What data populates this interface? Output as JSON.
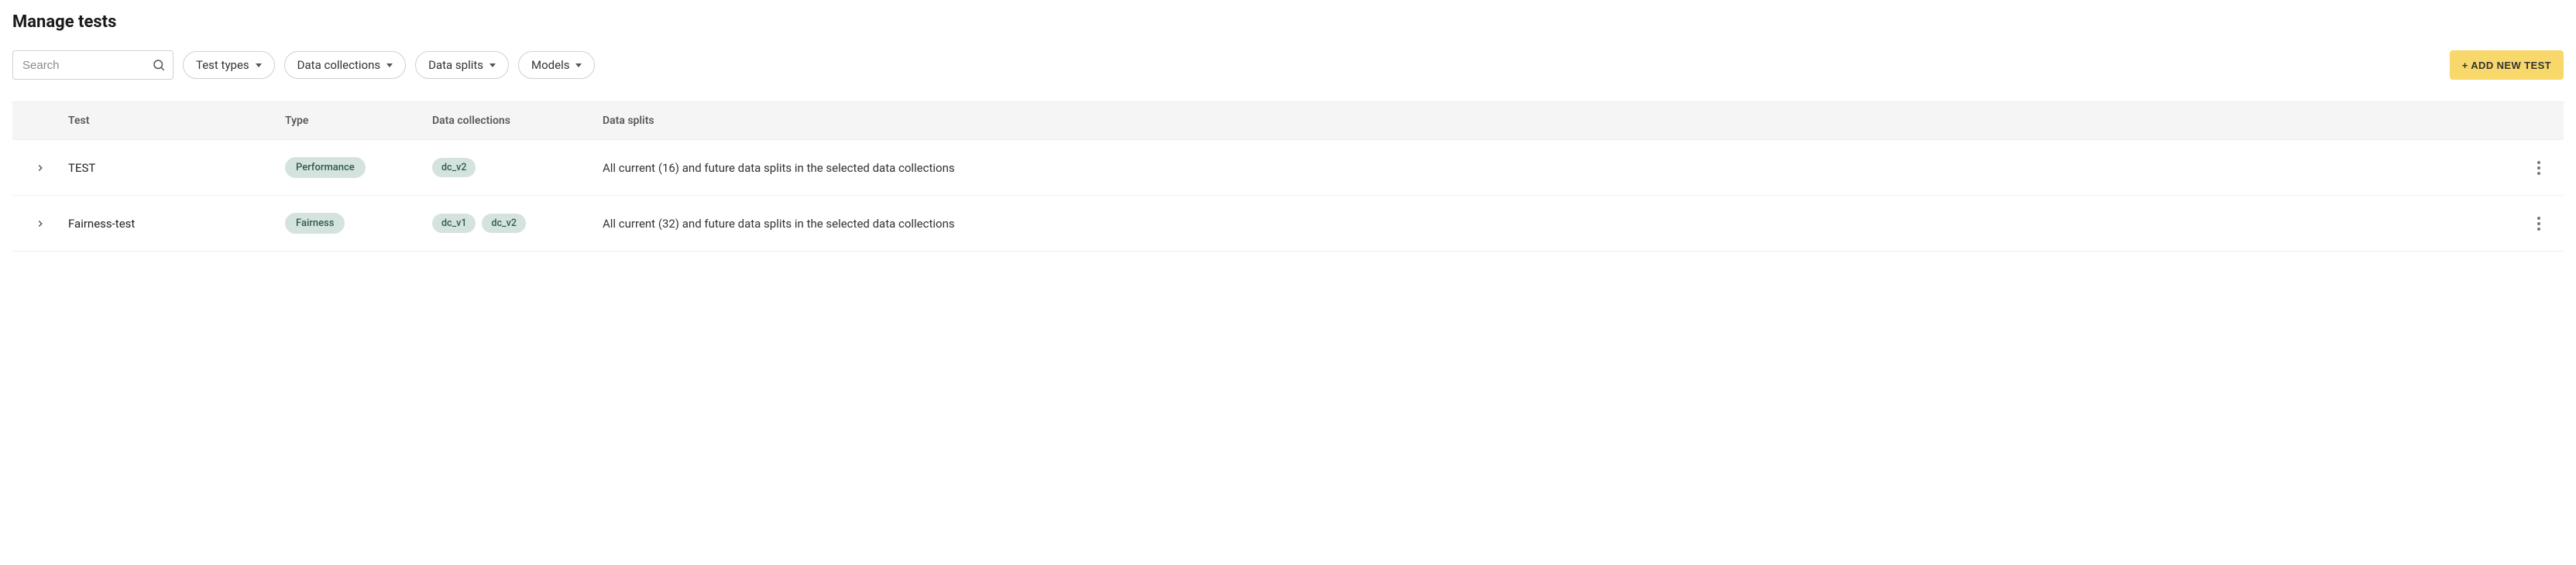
{
  "page_title": "Manage tests",
  "toolbar": {
    "search_placeholder": "Search",
    "filters": {
      "test_types": "Test types",
      "data_collections": "Data collections",
      "data_splits": "Data splits",
      "models": "Models"
    },
    "add_button": "+ ADD NEW TEST"
  },
  "table": {
    "headers": {
      "test": "Test",
      "type": "Type",
      "data_collections": "Data collections",
      "data_splits": "Data splits"
    },
    "rows": [
      {
        "name": "TEST",
        "type": "Performance",
        "data_collections": [
          "dc_v2"
        ],
        "data_splits": "All current (16) and future data splits in the selected data collections"
      },
      {
        "name": "Fairness-test",
        "type": "Fairness",
        "data_collections": [
          "dc_v1",
          "dc_v2"
        ],
        "data_splits": "All current (32) and future data splits in the selected data collections"
      }
    ]
  }
}
